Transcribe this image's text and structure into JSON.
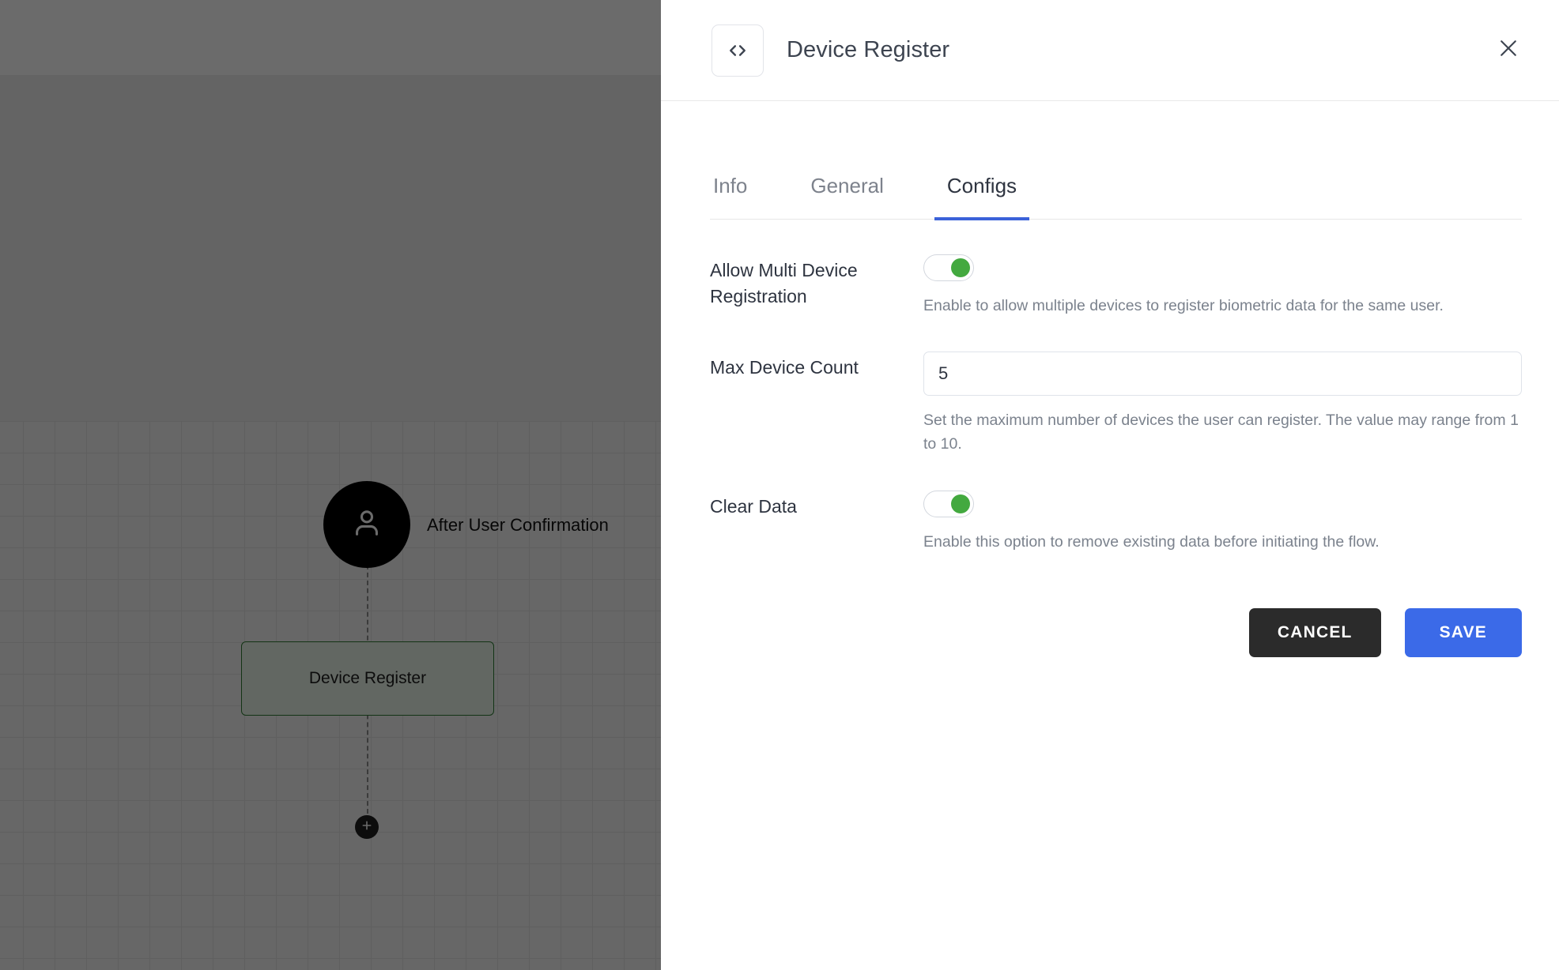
{
  "canvas": {
    "start_node": {
      "icon": "user-icon",
      "label": "After User Confirmation"
    },
    "flow_node": {
      "label": "Device Register"
    },
    "add_button": {
      "icon": "plus-icon"
    }
  },
  "modal": {
    "header": {
      "icon": "code-icon",
      "title": "Device Register",
      "close_icon": "close-icon"
    },
    "tabs": [
      {
        "label": "Info",
        "active": false
      },
      {
        "label": "General",
        "active": false
      },
      {
        "label": "Configs",
        "active": true
      }
    ],
    "fields": {
      "allow_multi_device": {
        "label": "Allow Multi Device Registration",
        "toggle_state": "on",
        "help": "Enable to allow multiple devices to register biometric data for the same user."
      },
      "max_device_count": {
        "label": "Max Device Count",
        "value": "5",
        "placeholder": "",
        "help": "Set the maximum number of devices the user can register. The value may range from 1 to 10."
      },
      "clear_data": {
        "label": "Clear Data",
        "toggle_state": "on",
        "help": "Enable this option to remove existing data before initiating the flow."
      }
    },
    "actions": {
      "cancel_label": "CANCEL",
      "save_label": "SAVE"
    }
  },
  "colors": {
    "accent_blue": "#3b6ae8",
    "tab_underline": "#3b62d9",
    "toggle_on": "#43a93f",
    "cancel_dark": "#2b2b2b",
    "node_border_green": "#2e7d32"
  }
}
